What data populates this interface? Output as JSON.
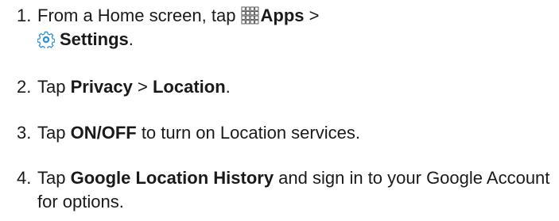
{
  "steps": [
    {
      "number": "1.",
      "t1": "From a Home screen, tap ",
      "apps_icon": "apps-grid-icon",
      "apps_label": "Apps",
      "sep": " >",
      "settings_icon": "settings-gear-icon",
      "settings_label": "Settings",
      "end": "."
    },
    {
      "number": "2.",
      "t1": "Tap ",
      "privacy": "Privacy",
      "sep": " > ",
      "location": "Location",
      "end": "."
    },
    {
      "number": "3.",
      "t1": "Tap ",
      "onoff": "ON/OFF",
      "t2": " to turn on Location services."
    },
    {
      "number": "4.",
      "t1": "Tap ",
      "google_history": "Google Location History",
      "t2": " and sign in to your Google Account for options."
    }
  ],
  "colors": {
    "text": "#1a1a1a",
    "gear_blue": "#2f8fd0"
  }
}
